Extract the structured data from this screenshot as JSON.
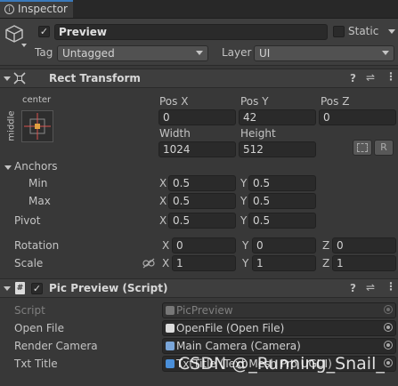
{
  "window": {
    "tab_label": "Inspector",
    "menu_icon": "kebab-menu-icon"
  },
  "gameobject": {
    "active": true,
    "name": "Preview",
    "static_label": "Static",
    "static_checked": false,
    "tag_label": "Tag",
    "tag_value": "Untagged",
    "layer_label": "Layer",
    "layer_value": "UI"
  },
  "rect_transform": {
    "title": "Rect Transform",
    "anchor_preset_top": "center",
    "anchor_preset_side": "middle",
    "col_labels": [
      "Pos X",
      "Pos Y",
      "Pos Z"
    ],
    "pos": [
      "0",
      "42",
      "0"
    ],
    "size_labels": [
      "Width",
      "Height"
    ],
    "size": [
      "1024",
      "512"
    ],
    "r_button": "R",
    "anchors_label": "Anchors",
    "min_label": "Min",
    "max_label": "Max",
    "min": [
      "0.5",
      "0.5"
    ],
    "max": [
      "0.5",
      "0.5"
    ],
    "pivot_label": "Pivot",
    "pivot": [
      "0.5",
      "0.5"
    ],
    "rotation_label": "Rotation",
    "rotation": [
      "0",
      "0",
      "0"
    ],
    "scale_label": "Scale",
    "scale": [
      "1",
      "1",
      "1"
    ],
    "axis": [
      "X",
      "Y",
      "Z"
    ]
  },
  "script_component": {
    "title": "Pic Preview (Script)",
    "enabled": true,
    "rows": [
      {
        "label": "Script",
        "value": "PicPreview",
        "disabled": true
      },
      {
        "label": "Open File",
        "value": "OpenFile (Open File)"
      },
      {
        "label": "Render Camera",
        "value": "Main Camera (Camera)"
      },
      {
        "label": "Txt Title",
        "value": "TxtTitle (Text Mesh Pro UGUI)"
      }
    ]
  },
  "watermark": "CSDN @_Running_Snail_",
  "colors": {
    "accent": "#3a79bb",
    "background": "#383838",
    "field": "#2a2a2a"
  }
}
